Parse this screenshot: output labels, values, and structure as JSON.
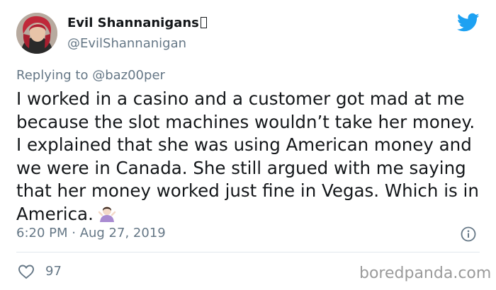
{
  "tweet": {
    "author_name": "Evil Shannanigans",
    "author_handle": "@EvilShannanigan",
    "replying_prefix": "Replying to ",
    "replying_mention": "@baz00per",
    "text": "I worked in a casino and a customer got mad at me because the slot machines wouldn’t take her money. I explained that she was using American money and we were in Canada. She still argued with me saying that her money worked just fine in Vegas. Which is in America.",
    "timestamp": "6:20 PM · Aug 27, 2019",
    "like_count": "97"
  },
  "watermark": "boredpanda.com",
  "icons": {
    "brand": "twitter-bird-icon",
    "emoji": "person-shrugging-emoji",
    "info": "info-icon",
    "like": "heart-icon"
  },
  "colors": {
    "twitter_blue": "#1da1f2",
    "secondary_text": "#657786",
    "divider": "#e1e8ed"
  }
}
